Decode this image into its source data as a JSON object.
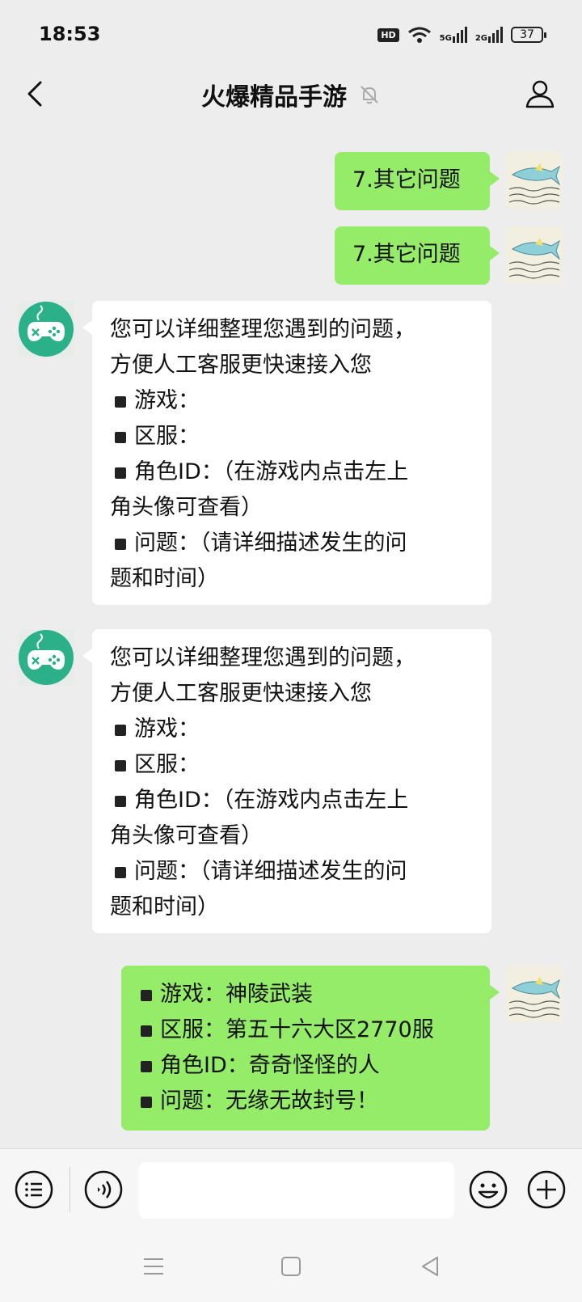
{
  "status": {
    "time": "18:53",
    "hd": "HD",
    "net1": "5G",
    "net2": "2G",
    "battery": "37"
  },
  "header": {
    "title": "火爆精品手游"
  },
  "messages": [
    {
      "side": "right",
      "lines": [
        "7.其它问题"
      ]
    },
    {
      "side": "right",
      "lines": [
        "7.其它问题"
      ]
    },
    {
      "side": "left",
      "lines": [
        "您可以详细整理您遇到的问题，",
        "方便人工客服更快速接入您"
      ],
      "items": [
        "游戏：",
        "区服：",
        "角色ID：（在游戏内点击左上",
        "角头像可查看）",
        "问题：（请详细描述发生的问",
        "题和时间）"
      ]
    },
    {
      "side": "left",
      "lines": [
        "您可以详细整理您遇到的问题，",
        "方便人工客服更快速接入您"
      ],
      "items": [
        "游戏：",
        "区服：",
        "角色ID：（在游戏内点击左上",
        "角头像可查看）",
        "问题：（请详细描述发生的问",
        "题和时间）"
      ]
    },
    {
      "side": "right",
      "items": [
        "游戏：神陵武装",
        "区服：第五十六大区2770服",
        "角色ID：奇奇怪怪的人",
        "问题：无缘无故封号！"
      ]
    }
  ],
  "icons": {
    "back": "back-arrow-icon",
    "mute": "bell-muted-icon",
    "profile": "person-icon",
    "list": "list-icon",
    "voice": "voice-icon",
    "emoji": "emoji-icon",
    "plus": "plus-icon"
  },
  "colors": {
    "bubble_self": "#95ec69",
    "bubble_other": "#ffffff",
    "background": "#ededed",
    "avatar_bot": "#2bb08a"
  }
}
